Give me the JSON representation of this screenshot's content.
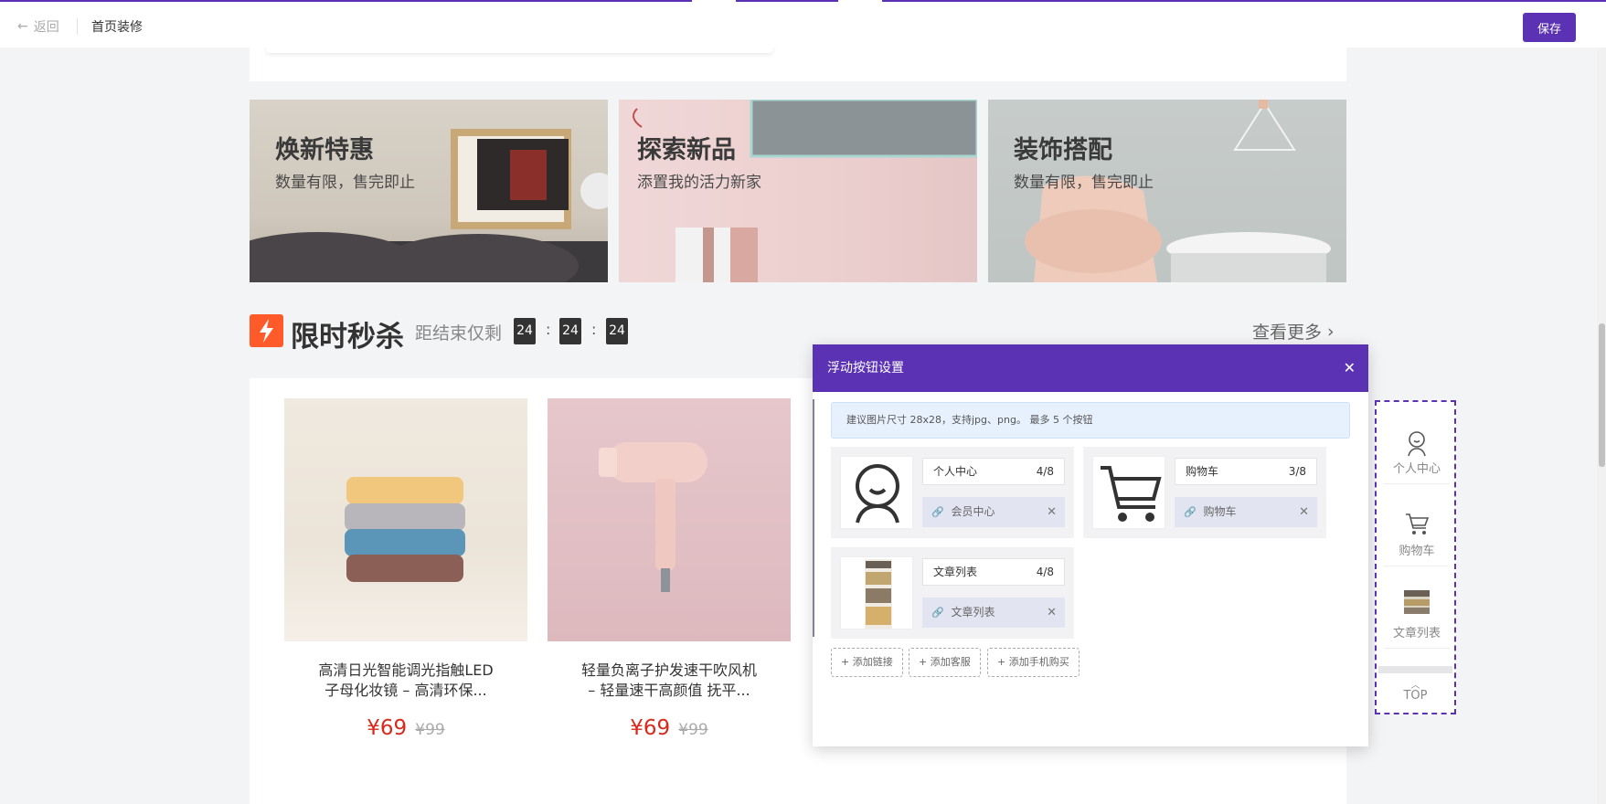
{
  "header": {
    "back_label": "返回",
    "page_title": "首页装修",
    "save_label": "保存"
  },
  "banners": [
    {
      "title": "焕新特惠",
      "subtitle": "数量有限，售完即止"
    },
    {
      "title": "探索新品",
      "subtitle": "添置我的活力新家"
    },
    {
      "title": "装饰搭配",
      "subtitle": "数量有限，售完即止"
    }
  ],
  "flash_sale": {
    "title": "限时秒杀",
    "countdown_label": "距结束仅剩",
    "hours": "24",
    "minutes": "24",
    "seconds": "24",
    "colon": ":",
    "more_label": "查看更多"
  },
  "products": [
    {
      "name_line1": "高清日光智能调光指触LED",
      "name_line2": "子母化妆镜 – 高清环保...",
      "price": "¥69",
      "original_price": "¥99"
    },
    {
      "name_line1": "轻量负离子护发速干吹风机",
      "name_line2": "– 轻量速干高颜值 抚平...",
      "price": "¥69",
      "original_price": "¥99"
    }
  ],
  "modal": {
    "title": "浮动按钮设置",
    "notice": "建议图片尺寸 28x28，支持jpg、png。 最多 5 个按钮",
    "buttons": [
      {
        "name": "个人中心",
        "count": "4/8",
        "link": "会员中心",
        "icon": "person-icon"
      },
      {
        "name": "购物车",
        "count": "3/8",
        "link": "购物车",
        "icon": "cart-icon"
      },
      {
        "name": "文章列表",
        "count": "4/8",
        "link": "文章列表",
        "icon": "article-thumbnail"
      }
    ],
    "add_buttons": [
      "+ 添加链接",
      "+ 添加客服",
      "+ 添加手机购买"
    ]
  },
  "float_preview": {
    "items": [
      {
        "label": "个人中心",
        "icon": "person-icon"
      },
      {
        "label": "购物车",
        "icon": "cart-icon"
      },
      {
        "label": "文章列表",
        "icon": "article-thumbnail"
      }
    ],
    "top_label": "TOP"
  },
  "colors": {
    "accent": "#5b32b4",
    "flash": "#ff5a2a",
    "price": "#d9281c"
  }
}
